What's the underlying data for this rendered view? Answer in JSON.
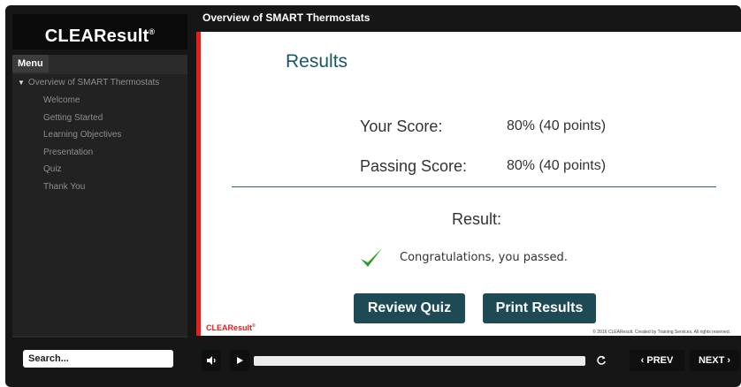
{
  "sidebar": {
    "logo": "CLEAResult",
    "logo_mark": "®",
    "menu_tab": "Menu",
    "menu_parent": "Overview of SMART Thermostats",
    "menu_items": [
      "Welcome",
      "Getting Started",
      "Learning Objectives",
      "Presentation",
      "Quiz",
      "Thank You"
    ],
    "search_placeholder": "Search..."
  },
  "slide": {
    "title": "Overview of SMART Thermostats",
    "heading": "Results",
    "your_score_label": "Your Score:",
    "your_score_value": "80% (40 points)",
    "passing_score_label": "Passing Score:",
    "passing_score_value": "80% (40 points)",
    "result_label": "Result:",
    "result_message": "Congratulations, you passed.",
    "review_button": "Review Quiz",
    "print_button": "Print Results",
    "footer_logo": "CLEAResult",
    "footer_mark": "®",
    "copyright": "© 2016 CLEAResult. Created by Training Services. All rights reserved."
  },
  "controls": {
    "mute_icon": "speaker-icon",
    "play_icon": "play-icon",
    "replay_icon": "replay-icon",
    "progress": 0.0,
    "prev_label": "‹ PREV",
    "next_label": "NEXT ›"
  },
  "colors": {
    "accent_red": "#e32119",
    "teal": "#1d4a55",
    "check_green": "#2e9b2e"
  }
}
